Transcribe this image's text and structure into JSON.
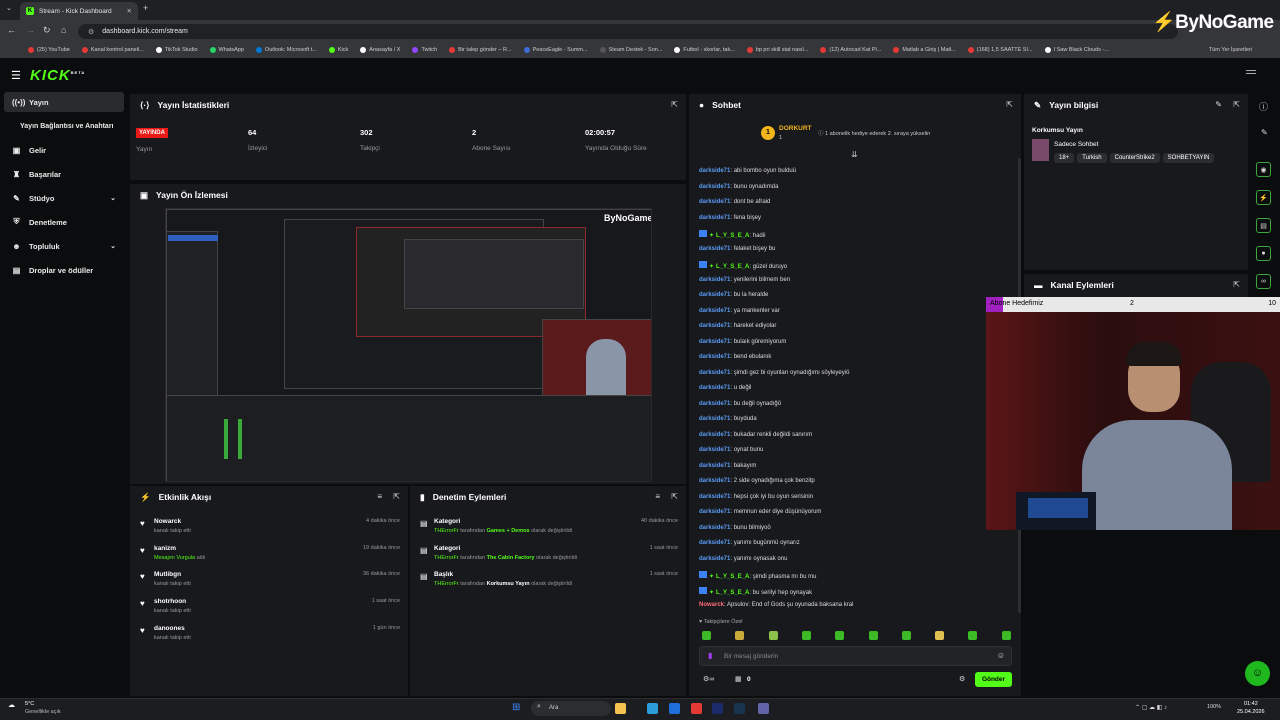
{
  "browser": {
    "tab_title": "Stream - Kick Dashboard",
    "url": "dashboard.kick.com/stream",
    "bookmarks": [
      "(25) YouTube",
      "Kanal kontrol paneli...",
      "TikTok Studio",
      "WhatsApp",
      "Outlook: Microsoft t...",
      "Kick",
      "Anasayfa / X",
      "Twitch",
      "Bir talep gönder – R...",
      "PeaceEagle - Summ...",
      "Steam Destek - Son...",
      "Futbol - skorlar, tak...",
      "bp pri skill stat nasıl...",
      "(12) Autocad Kat Pl...",
      "Matlab a Giriş | Matl...",
      "(168) 1,5 SAATTE SI...",
      "I Saw Black Clouds -..."
    ],
    "all_bookmarks": "Tüm Yer İşaretleri"
  },
  "watermark": "ByNoGame",
  "kick": {
    "logo": "KICK",
    "logo_badge": "BETA"
  },
  "sidebar": {
    "items": [
      {
        "label": "Yayın",
        "icon": "broadcast-icon"
      },
      {
        "label": "Yayın Bağlantısı ve Anahtarı",
        "icon": ""
      },
      {
        "label": "Gelir",
        "icon": "wallet-icon"
      },
      {
        "label": "Başarılar",
        "icon": "trophy-icon"
      },
      {
        "label": "Stüdyo",
        "icon": "studio-icon"
      },
      {
        "label": "Denetleme",
        "icon": "shield-icon"
      },
      {
        "label": "Topluluk",
        "icon": "community-icon"
      },
      {
        "label": "Droplar ve ödüller",
        "icon": "gift-icon"
      }
    ]
  },
  "stats": {
    "title": "Yayın İstatistikleri",
    "live_badge": "YAYINDA",
    "live_label": "Yayın",
    "viewers": "64",
    "viewers_label": "İzleyici",
    "followers": "302",
    "followers_label": "Takipçi",
    "subs": "2",
    "subs_label": "Abone Sayısı",
    "uptime": "02:00:57",
    "uptime_label": "Yayında Olduğu Süre"
  },
  "preview": {
    "title": "Yayın Ön İzlemesi"
  },
  "activity": {
    "title": "Etkinlik Akışı",
    "items": [
      {
        "name": "Nowarck",
        "sub": "kanalı takip etti",
        "highlight": "",
        "time": "4 dakika önce"
      },
      {
        "name": "kanizm",
        "sub": "aldı",
        "highlight": "Mesajını Vurgula",
        "time": "19 dakika önce"
      },
      {
        "name": "Mutlibgn",
        "sub": "kanalı takip etti",
        "highlight": "",
        "time": "36 dakika önce"
      },
      {
        "name": "shotrhoon",
        "sub": "kanalı takip etti",
        "highlight": "",
        "time": "1 saat önce"
      },
      {
        "name": "danoones",
        "sub": "kanalı takip etti",
        "highlight": "",
        "time": "1 gün önce"
      }
    ]
  },
  "moderation": {
    "title": "Denetim Eylemleri",
    "items": [
      {
        "name": "Kategori",
        "actor": "THErrorFr",
        "mid": "tarafından",
        "value": "Games + Demos",
        "end": "olarak değiştirildi",
        "time": "40 dakika önce",
        "value_green": true
      },
      {
        "name": "Kategori",
        "actor": "THErrorFr",
        "mid": "tarafından",
        "value": "The Cabin Factory",
        "end": "olarak değiştirildi",
        "time": "1 saat önce",
        "value_green": true
      },
      {
        "name": "Başlık",
        "actor": "THErrorFr",
        "mid": "tarafından",
        "value": "Korkumsu Yayın",
        "end": "olarak değiştirildi",
        "time": "1 saat önce",
        "value_green": false
      }
    ]
  },
  "chat": {
    "title": "Sohbet",
    "pinned_user": "DORKURT",
    "pinned_count": "1",
    "pinned_msg": "1 abonelik hediye ederek 2. sıraya yükselin",
    "messages": [
      {
        "user": "darkside71",
        "text": "abi bombo oyun bulduü",
        "type": "b"
      },
      {
        "user": "darkside71",
        "text": "bunu oynadımda",
        "type": "b"
      },
      {
        "user": "darkside71",
        "text": "dont be afraid",
        "type": "b"
      },
      {
        "user": "darkside71",
        "text": "fena bişey",
        "type": "b"
      },
      {
        "user": "L_Y_S_E_A",
        "text": "hadii",
        "type": "g"
      },
      {
        "user": "darkside71",
        "text": "felaket bişey bu",
        "type": "b"
      },
      {
        "user": "L_Y_S_E_A",
        "text": "güzel duruyo",
        "type": "g"
      },
      {
        "user": "darkside71",
        "text": "yenilerini bilmem ben",
        "type": "b"
      },
      {
        "user": "darkside71",
        "text": "bu la heralde",
        "type": "b"
      },
      {
        "user": "darkside71",
        "text": "ya mankenler var",
        "type": "b"
      },
      {
        "user": "darkside71",
        "text": "hareket ediyolar",
        "type": "b"
      },
      {
        "user": "darkside71",
        "text": "bulaık göremiyorum",
        "type": "b"
      },
      {
        "user": "darkside71",
        "text": "bend ebulanık",
        "type": "b"
      },
      {
        "user": "darkside71",
        "text": "şimdi gez bi oyunları oynadığımı söyleyeyiö",
        "type": "b"
      },
      {
        "user": "darkside71",
        "text": "u değil",
        "type": "b"
      },
      {
        "user": "darkside71",
        "text": "bu değil oynadığö",
        "type": "b"
      },
      {
        "user": "darkside71",
        "text": "buyduda",
        "type": "b"
      },
      {
        "user": "darkside71",
        "text": "bukadar renkli değildi sanırım",
        "type": "b"
      },
      {
        "user": "darkside71",
        "text": "oynat bunu",
        "type": "b"
      },
      {
        "user": "darkside71",
        "text": "bakayım",
        "type": "b"
      },
      {
        "user": "darkside71",
        "text": "2 side oynadığıma çok benzitp",
        "type": "b"
      },
      {
        "user": "darkside71",
        "text": "hepsi çok iyi bu oyun serisinin",
        "type": "b"
      },
      {
        "user": "darkside71",
        "text": "memnun eder diye düşünüyorum",
        "type": "b"
      },
      {
        "user": "darkside71",
        "text": "bunu bilmiyoö",
        "type": "b"
      },
      {
        "user": "darkside71",
        "text": "yanımı bugünmü oynarız",
        "type": "b"
      },
      {
        "user": "darkside71",
        "text": "yanımı oynasak onu",
        "type": "b"
      },
      {
        "user": "L_Y_S_E_A",
        "text": "şimdi phasma mı bu mu",
        "type": "g"
      },
      {
        "user": "L_Y_S_E_A",
        "text": "bu serilyi hep oynayak",
        "type": "g"
      },
      {
        "user": "Nowarck",
        "text": "Apsulov: End of Gods şu oyunada baksana kral",
        "type": "r"
      }
    ],
    "followers_only": "Takipçilere Özel",
    "input_placeholder": "Bir mesaj gönderin",
    "count": "0",
    "send": "Gönder"
  },
  "stream_info": {
    "title": "Yayın bilgisi",
    "stream_title": "Korkumsu Yayın",
    "category": "Sadece Sohbet",
    "tags": [
      "18+",
      "Turkish",
      "CounterStrike2",
      "SOHBETYAYIN"
    ]
  },
  "channel_actions": {
    "title": "Kanal Eylemleri"
  },
  "sub_goal": {
    "label": "Abone Hedefimiz",
    "current": "2",
    "target": "10",
    "progress": 0.2
  },
  "taskbar": {
    "weather_temp": "5°C",
    "weather_desc": "Genellikle açık",
    "search": "Ara",
    "battery": "100%",
    "time": "01:42",
    "date": "25.04.2026"
  }
}
